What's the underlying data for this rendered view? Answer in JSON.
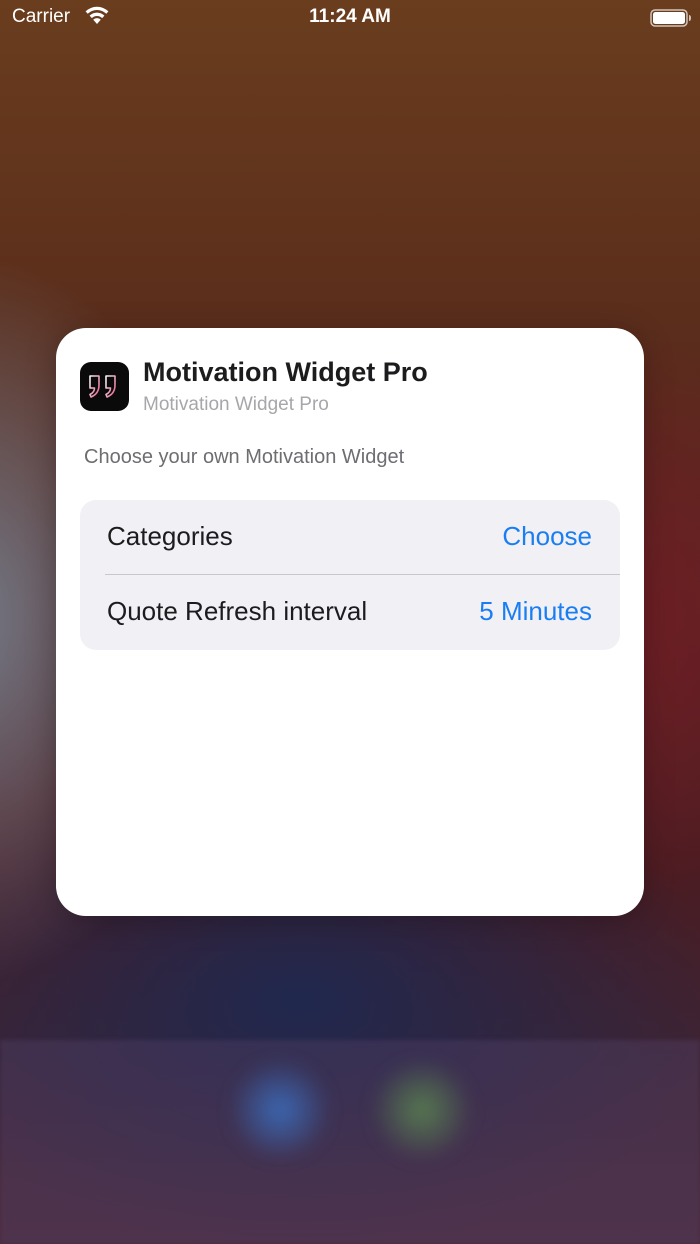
{
  "status_bar": {
    "carrier": "Carrier",
    "time": "11:24 AM",
    "icons": [
      "wifi-icon",
      "battery-icon"
    ]
  },
  "widget": {
    "app_icon": "quote-marks-icon",
    "title": "Motivation Widget Pro",
    "subtitle": "Motivation Widget Pro",
    "description": "Choose your own Motivation Widget",
    "settings": [
      {
        "label": "Categories",
        "value": "Choose"
      },
      {
        "label": "Quote Refresh interval",
        "value": "5 Minutes"
      }
    ]
  },
  "colors": {
    "accent": "#1a7ef2",
    "card_background": "#ffffff",
    "group_background": "#f1f1f5"
  }
}
